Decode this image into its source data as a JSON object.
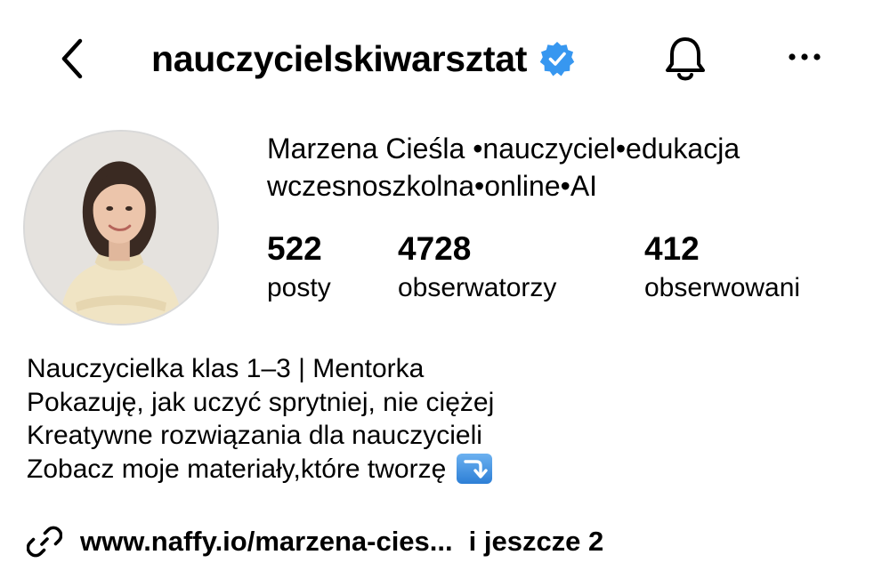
{
  "header": {
    "username": "nauczycielskiwarsztat",
    "verified": true,
    "back_icon": "chevron-left-icon",
    "bell_icon": "bell-icon",
    "more_icon": "more-horizontal-icon",
    "verified_color": "#3797f0"
  },
  "profile": {
    "full_name": "Marzena Cieśla •nauczyciel•edukacja wczesnoszkolna•online•AI",
    "stats": {
      "posts": {
        "count": "522",
        "label": "posty"
      },
      "followers": {
        "count": "4728",
        "label": "obserwatorzy"
      },
      "following": {
        "count": "412",
        "label": "obserwowani"
      }
    }
  },
  "bio": {
    "lines": [
      "Nauczycielka klas 1–3 | Mentorka",
      "Pokazuję, jak uczyć sprytniej, nie ciężej",
      "Kreatywne rozwiązania dla nauczycieli",
      "Zobacz moje materiały,które tworzę"
    ],
    "emoji": "arrow-down-right-icon"
  },
  "link": {
    "url": "www.naffy.io/marzena-cies...",
    "more": "i jeszcze 2",
    "icon": "link-icon"
  }
}
